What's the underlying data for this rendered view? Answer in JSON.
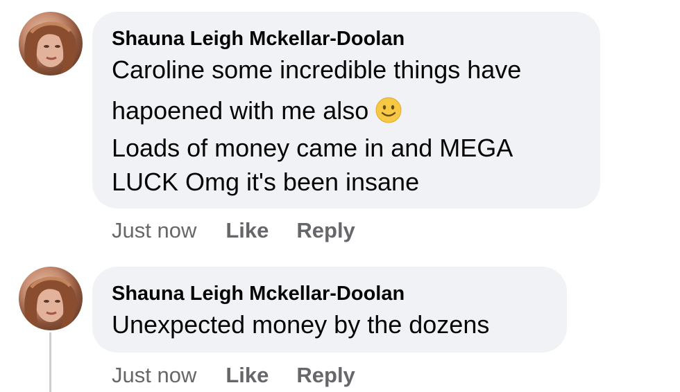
{
  "comments": [
    {
      "author": "Shauna Leigh Mckellar-Doolan",
      "lines": [
        "Caroline some incredible things have",
        "hapoened with me also",
        "Loads of money came in and MEGA",
        "LUCK Omg it's been insane"
      ],
      "emoji": "slightly-smiling-face",
      "time": "Just now",
      "like_label": "Like",
      "reply_label": "Reply"
    },
    {
      "author": "Shauna Leigh Mckellar-Doolan",
      "lines": [
        "Unexpected money by the dozens"
      ],
      "time": "Just now",
      "like_label": "Like",
      "reply_label": "Reply"
    }
  ],
  "colors": {
    "bubble_bg": "#f0f2f5",
    "text": "#050505",
    "meta_text": "#65676b",
    "emoji_yellow": "#f7c843"
  }
}
